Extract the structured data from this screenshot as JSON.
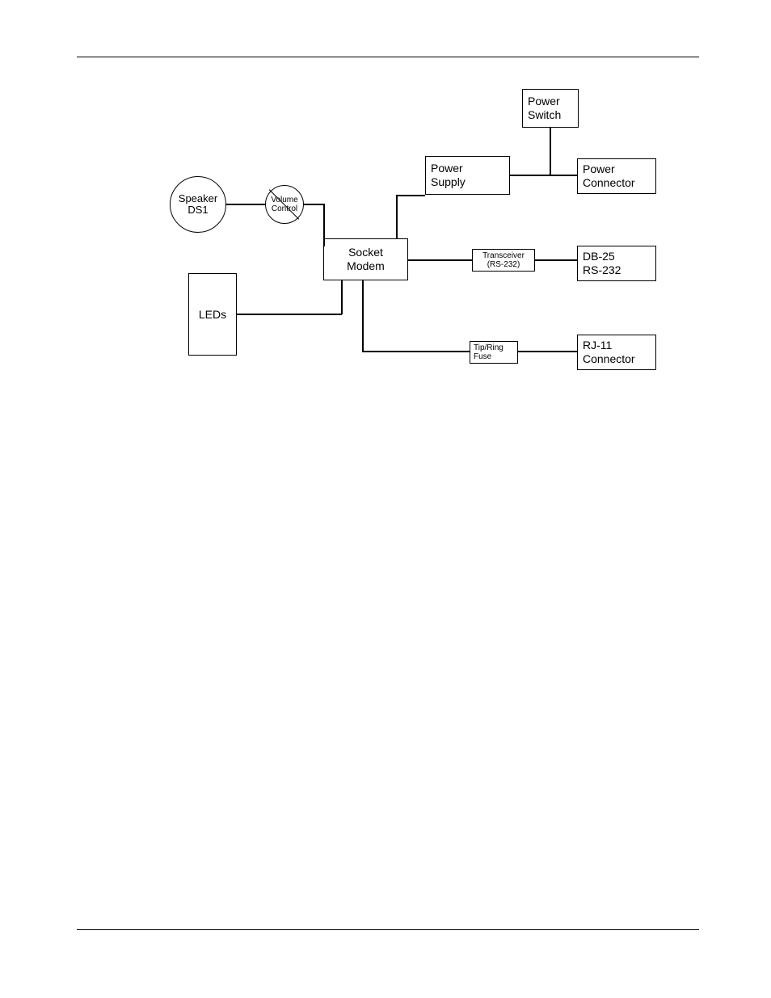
{
  "blocks": {
    "power_switch": {
      "l1": "Power",
      "l2": "Switch"
    },
    "power_supply": {
      "l1": "Power",
      "l2": "Supply"
    },
    "power_connector": {
      "l1": "Power",
      "l2": "Connector"
    },
    "speaker": {
      "l1": "Speaker",
      "l2": "DS1"
    },
    "volume": {
      "l1": "Volume",
      "l2": "Control"
    },
    "socket_modem": {
      "l1": "Socket",
      "l2": "Modem"
    },
    "transceiver": {
      "l1": "Transceiver",
      "l2": "(RS-232)"
    },
    "db25": {
      "l1": "DB-25",
      "l2": "RS-232"
    },
    "leds": {
      "l1": "LEDs"
    },
    "tipring": {
      "l1": "Tip/Ring",
      "l2": "Fuse"
    },
    "rj11": {
      "l1": "RJ-11",
      "l2": "Connector"
    }
  }
}
